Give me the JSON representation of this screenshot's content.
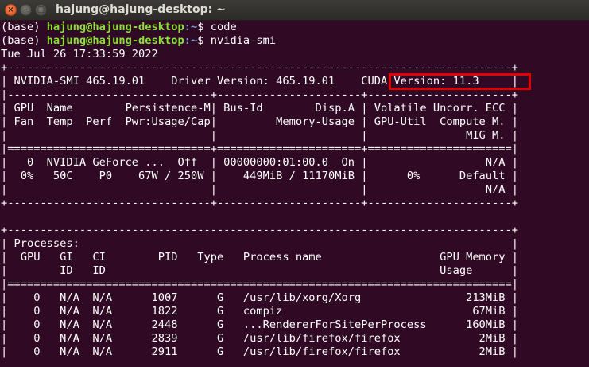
{
  "window": {
    "title": "hajung@hajung-desktop: ~",
    "close_glyph": "×",
    "minimize_glyph": "–",
    "maximize_glyph": "□"
  },
  "commands": [
    {
      "env": "(base) ",
      "user_host": "hajung@hajung-desktop",
      "path": ":~",
      "symbol": "$ ",
      "command": "code"
    },
    {
      "env": "(base) ",
      "user_host": "hajung@hajung-desktop",
      "path": ":~",
      "symbol": "$ ",
      "command": "nvidia-smi"
    }
  ],
  "output": [
    "Tue Jul 26 17:33:59 2022",
    "+-----------------------------------------------------------------------------+",
    "| NVIDIA-SMI 465.19.01    Driver Version: 465.19.01    CUDA Version: 11.3     |",
    "|-------------------------------+----------------------+----------------------+",
    "| GPU  Name        Persistence-M| Bus-Id        Disp.A | Volatile Uncorr. ECC |",
    "| Fan  Temp  Perf  Pwr:Usage/Cap|         Memory-Usage | GPU-Util  Compute M. |",
    "|                               |                      |               MIG M. |",
    "|===============================+======================+======================|",
    "|   0  NVIDIA GeForce ...  Off  | 00000000:01:00.0  On |                  N/A |",
    "|  0%   50C    P0    67W / 250W |    449MiB / 11170MiB |      0%      Default |",
    "|                               |                      |                  N/A |",
    "+-------------------------------+----------------------+----------------------+",
    "",
    "+-----------------------------------------------------------------------------+",
    "| Processes:                                                                  |",
    "|  GPU   GI   CI        PID   Type   Process name                  GPU Memory |",
    "|        ID   ID                                                   Usage      |",
    "|=============================================================================|",
    "|    0   N/A  N/A      1007      G   /usr/lib/xorg/Xorg                213MiB |",
    "|    0   N/A  N/A      1822      G   compiz                             67MiB |",
    "|    0   N/A  N/A      2448      G   ...RendererForSitePerProcess      160MiB |",
    "|    0   N/A  N/A      2839      G   /usr/lib/firefox/firefox            2MiB |",
    "|    0   N/A  N/A      2911      G   /usr/lib/firefox/firefox            2MiB |"
  ],
  "highlight": {
    "text": "CUDA Version: 11.3",
    "color": "#e00000"
  },
  "colors": {
    "background": "#300a24",
    "foreground": "#ffffff",
    "prompt_user": "#8ae234",
    "prompt_path": "#729fcf"
  }
}
